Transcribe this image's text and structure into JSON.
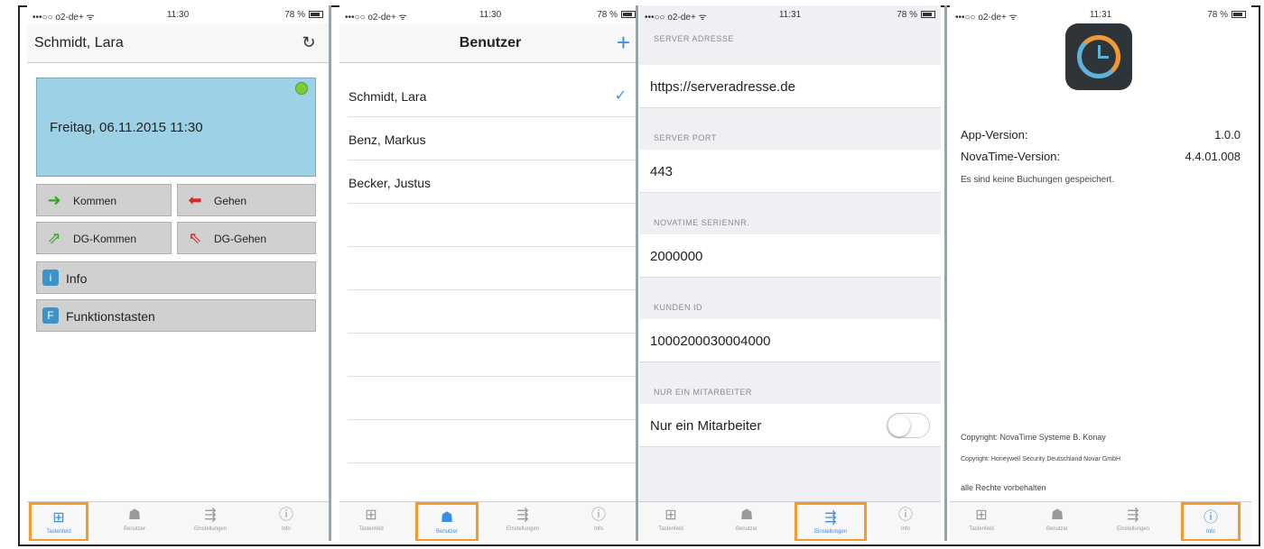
{
  "colors": {
    "accent": "#3b8ee6",
    "highlight": "#f29a2e",
    "panel": "#9dd2e6",
    "button_gray": "#d0d0d0"
  },
  "status_bar": [
    {
      "carrier": "•••○○ o2-de+ ᯤ",
      "time": "11:30",
      "battery": "78 %"
    },
    {
      "carrier": "•••○○ o2-de+ ᯤ",
      "time": "11:30",
      "battery": "78 %"
    },
    {
      "carrier": "•••○○ o2-de+ ᯤ",
      "time": "11:31",
      "battery": "78 %"
    },
    {
      "carrier": "•••○○ o2-de+ ᯤ",
      "time": "11:31",
      "battery": "78 %"
    }
  ],
  "tabs": [
    {
      "label": "Tastenfeld",
      "icon": "keypad-icon",
      "glyph": "⊞"
    },
    {
      "label": "Benutzer",
      "icon": "user-icon",
      "glyph": "☗"
    },
    {
      "label": "Einstellungen",
      "icon": "settings-icon",
      "glyph": "⇶"
    },
    {
      "label": "Info",
      "icon": "info-icon",
      "glyph": "ⓘ"
    }
  ],
  "screen1": {
    "title": "Schmidt, Lara",
    "refresh_icon": "↻",
    "datetime": "Freitag, 06.11.2015 11:30",
    "buttons": {
      "kommen": "Kommen",
      "gehen": "Gehen",
      "dg_kommen": "DG-Kommen",
      "dg_gehen": "DG-Gehen",
      "info": "Info",
      "info_badge": "i",
      "funktionstasten": "Funktionstasten",
      "funktionstasten_badge": "F"
    }
  },
  "screen2": {
    "title": "Benutzer",
    "add_icon": "+",
    "users": [
      "Schmidt, Lara",
      "Benz, Markus",
      "Becker, Justus"
    ],
    "check_icon": "✓"
  },
  "screen3": {
    "sections": [
      {
        "header": "SERVER ADRESSE",
        "value": "https://serveradresse.de"
      },
      {
        "header": "SERVER PORT",
        "value": "443"
      },
      {
        "header": "NOVATIME SERIENNR.",
        "value": "2000000"
      },
      {
        "header": "KUNDEN ID",
        "value": "1000200030004000"
      },
      {
        "header": "NUR EIN MITARBEITER",
        "value": "Nur ein Mitarbeiter"
      }
    ],
    "toggle_on": false
  },
  "screen4": {
    "app_version_label": "App-Version:",
    "app_version": "1.0.0",
    "novatime_version_label": "NovaTime-Version:",
    "novatime_version": "4.4.01.008",
    "no_bookings": "Es sind keine Buchungen gespeichert.",
    "copyright1": "Copyright: NovaTime Systeme B. Konay",
    "copyright2": "Copyright: Honeywell Security Deutschland Novar GmbH",
    "rights": "alle Rechte vorbehalten"
  }
}
